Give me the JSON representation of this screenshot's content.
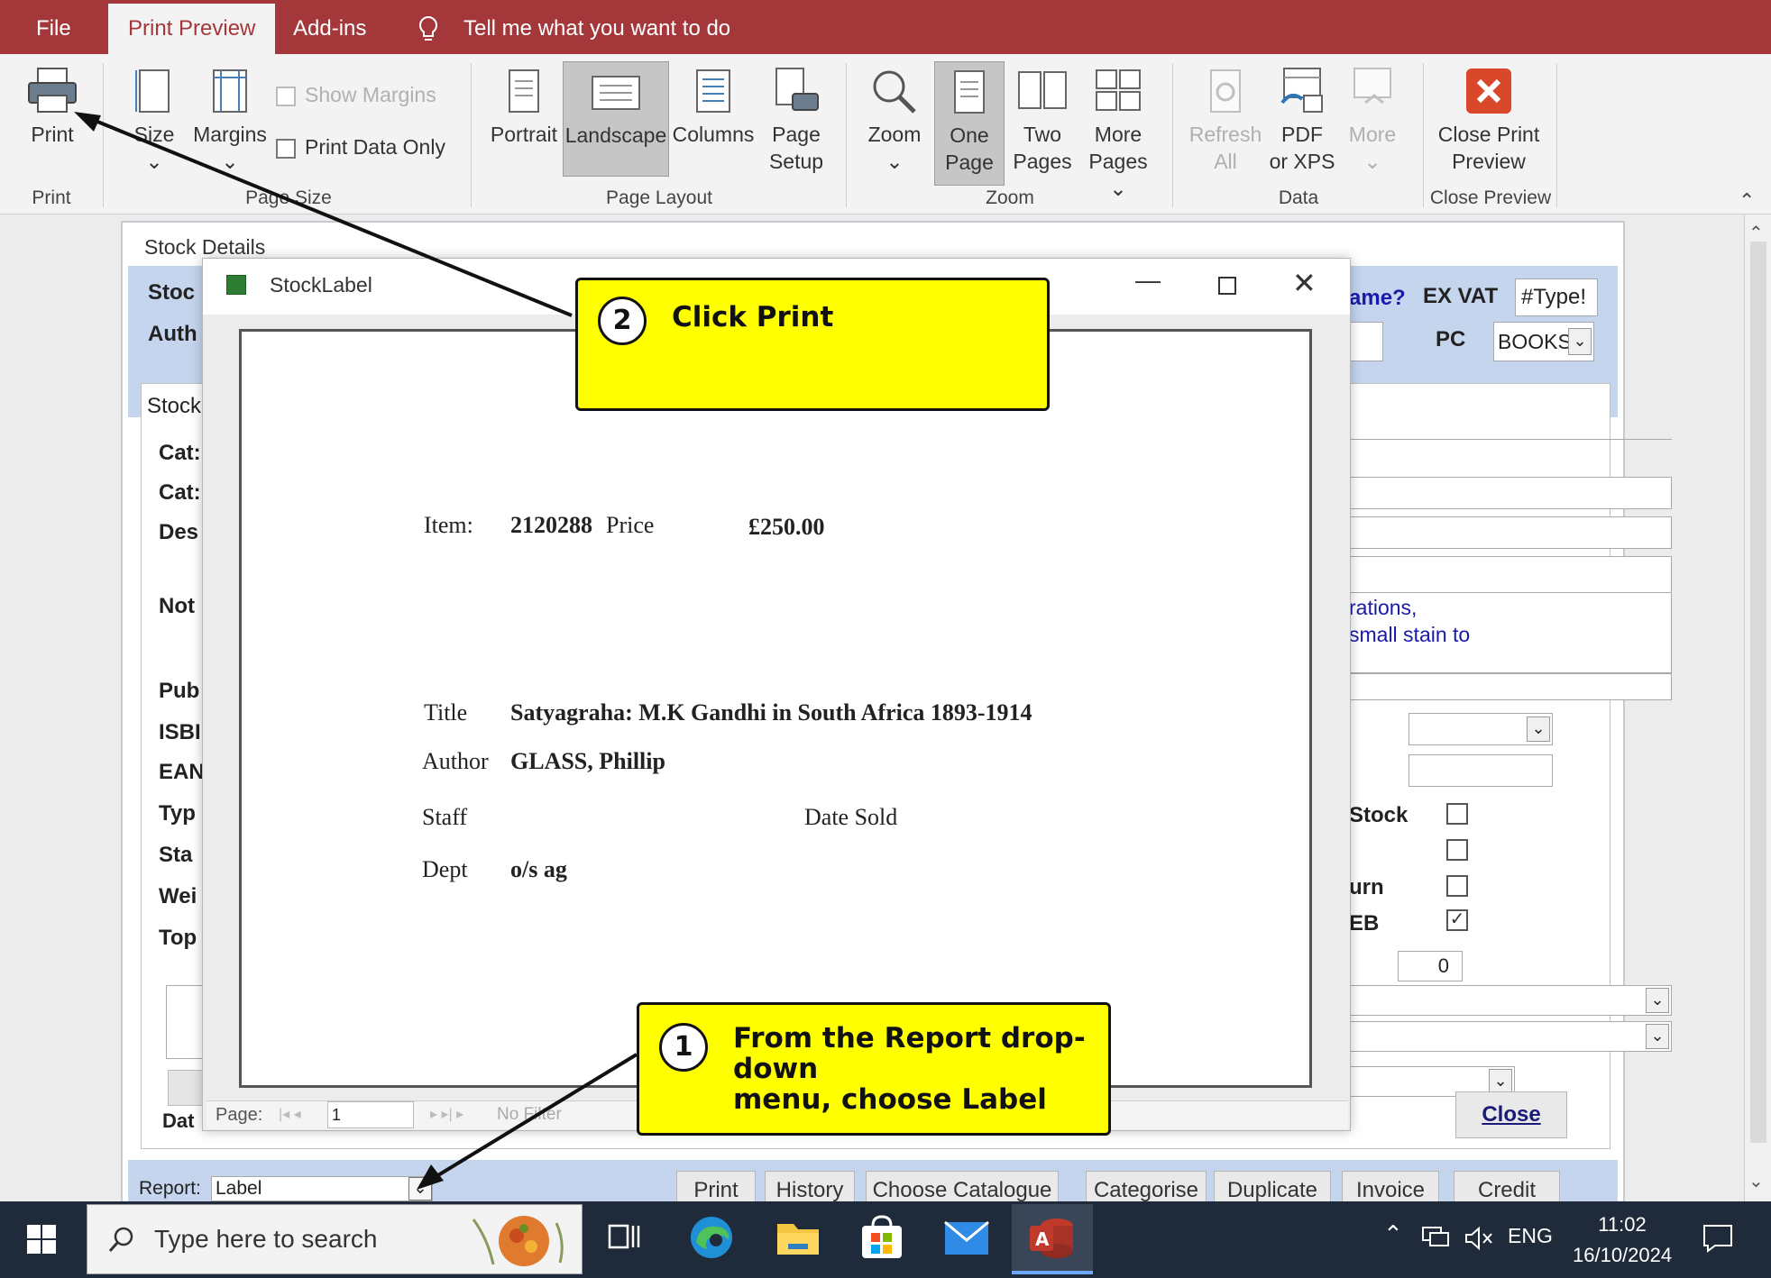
{
  "ribbon_tabs": [
    {
      "label": "File"
    },
    {
      "label": "Print Preview"
    },
    {
      "label": "Add-ins"
    },
    {
      "label": "Tell me what you want to do"
    }
  ],
  "ribbon": {
    "print": "Print",
    "size": "Size",
    "margins": "Margins",
    "show_margins": "Show Margins",
    "print_data_only": "Print Data Only",
    "portrait": "Portrait",
    "landscape": "Landscape",
    "columns": "Columns",
    "page_setup_1": "Page",
    "page_setup_2": "Setup",
    "zoom": "Zoom",
    "one_page_1": "One",
    "one_page_2": "Page",
    "two_pages_1": "Two",
    "two_pages_2": "Pages",
    "more_pages_1": "More",
    "more_pages_2": "Pages",
    "refresh_1": "Refresh",
    "refresh_2": "All",
    "pdf_1": "PDF",
    "pdf_2": "or XPS",
    "more": "More",
    "close_1": "Close Print",
    "close_2": "Preview",
    "groups": {
      "print": "Print",
      "page_size": "Page Size",
      "page_layout": "Page Layout",
      "zoom": "Zoom",
      "data": "Data",
      "close_preview": "Close Preview"
    }
  },
  "form": {
    "header": "Stock Details",
    "labels_left": [
      "Stoc",
      "Auth",
      "Cat:",
      "Cat:",
      "Des",
      "Not",
      "Pub",
      "ISBI",
      "EAN",
      "Typ",
      "Sta",
      "Wei",
      "Top",
      "Dat"
    ],
    "stock_tab": "Stock",
    "name_q": "ame?",
    "ex_vat": "EX VAT",
    "type_field": "#Type!",
    "pc": "PC",
    "pc_value": "BOOKS",
    "notes_line1": "rations,",
    "notes_line2": "small stain to",
    "stock_lbl": "Stock",
    "urn_lbl": "urn",
    "eb_lbl": "EB",
    "counter": "0",
    "close_btn": "Close",
    "report_label": "Report:",
    "report_value": "Label",
    "bottom_buttons": [
      "Print",
      "History",
      "Choose Catalogue",
      "Categorise",
      "Duplicate",
      "Invoice",
      "Credit"
    ]
  },
  "report_window": {
    "title": "StockLabel",
    "item_label": "Item:",
    "item_value": "2120288",
    "price_label": "Price",
    "price_value": "£250.00",
    "title_label": "Title",
    "title_value": "Satyagraha: M.K Gandhi in South Africa 1893-1914",
    "author_label": "Author",
    "author_value": "GLASS, Phillip",
    "staff_label": "Staff",
    "date_sold_label": "Date Sold",
    "dept_label": "Dept",
    "dept_value": "o/s ag",
    "page_label": "Page:",
    "page_value": "1",
    "no_filter": "No Filter"
  },
  "callouts": {
    "one": {
      "num": "1",
      "text1": "From the Report drop-down",
      "text2": "menu, choose Label"
    },
    "two": {
      "num": "2",
      "text": "Click Print"
    }
  },
  "taskbar": {
    "search_placeholder": "Type here to search",
    "lang": "ENG",
    "time": "11:02",
    "date": "16/10/2024"
  },
  "colors": {
    "ribbon_accent": "#a4373a",
    "callout": "#ffff00",
    "taskbar": "#1f2a3a"
  }
}
